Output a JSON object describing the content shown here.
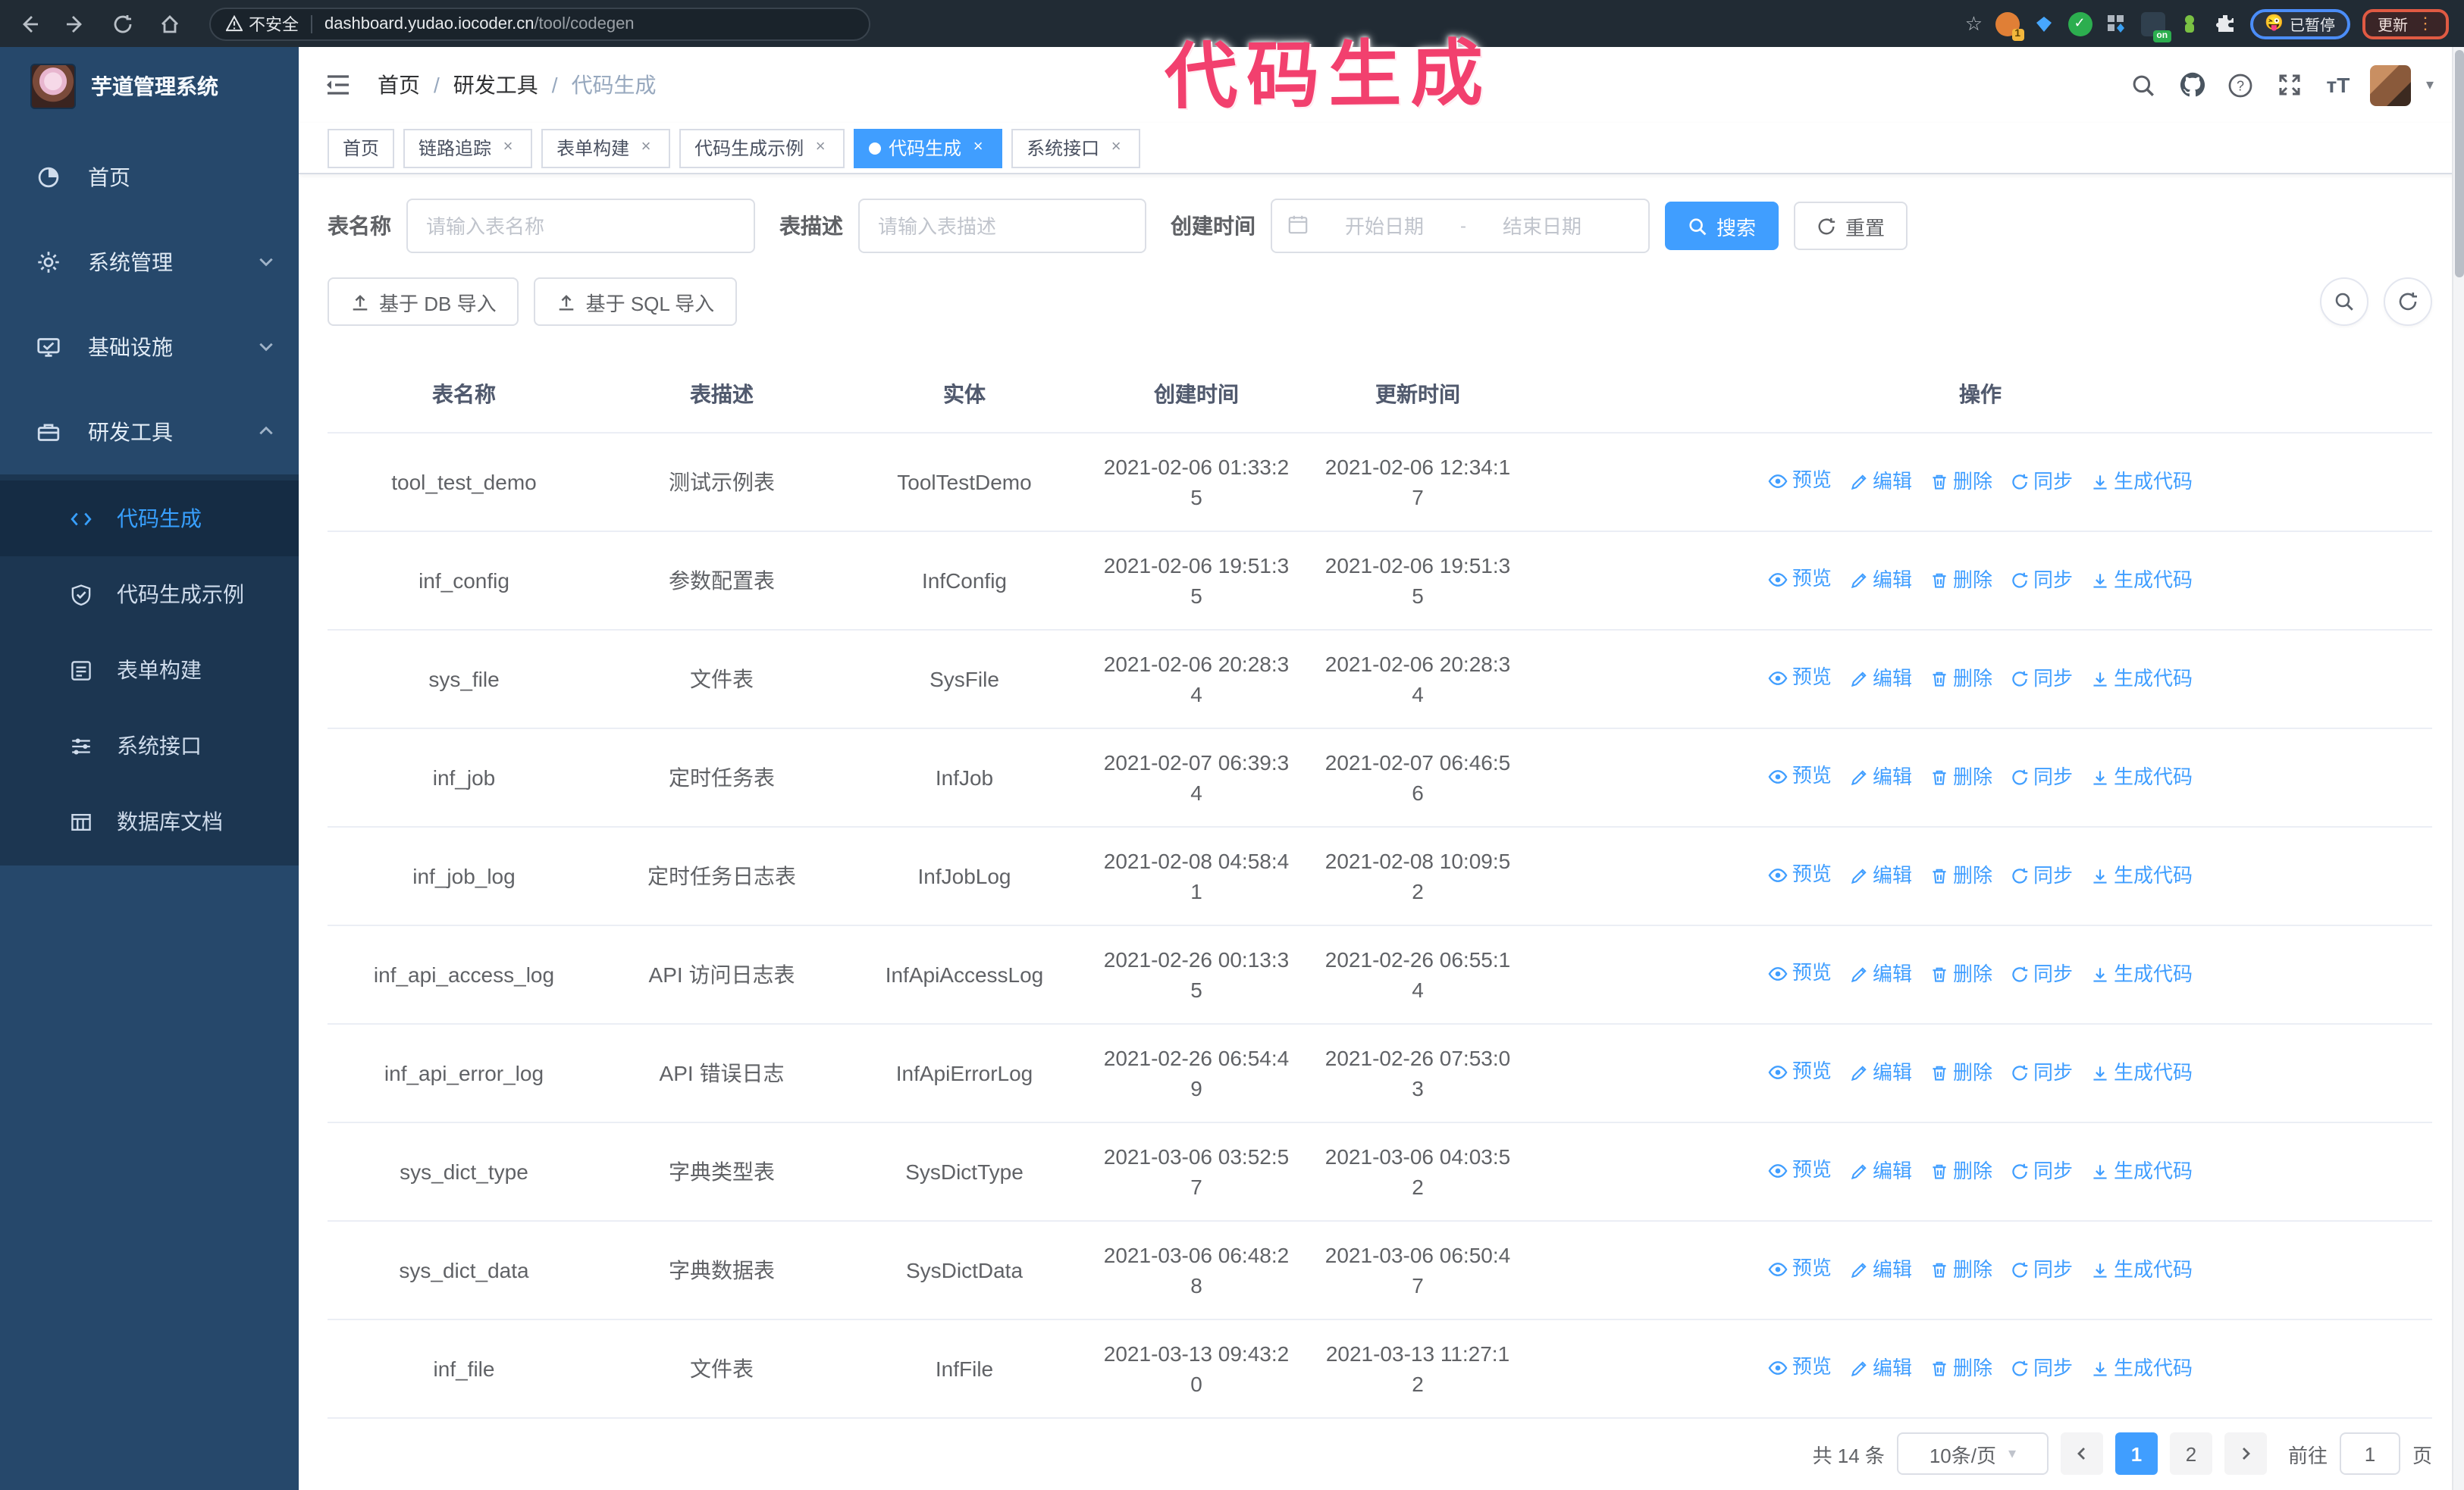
{
  "colors": {
    "accent": "#409eff",
    "annotation_pink": "#f2406e",
    "sidebar_bg": "#26486b",
    "submenu_bg": "#1c3651",
    "chrome_bg": "#212b34"
  },
  "glyphs": {
    "close": "×",
    "slash": "/",
    "dash": "-",
    "caret_down": "▾",
    "dots_vertical": "⋮",
    "star": "☆",
    "back": "←",
    "forward": "→"
  },
  "browser": {
    "security_label": "不安全",
    "url_host": "dashboard.yudao.iocoder.cn",
    "url_path": "/tool/codegen",
    "extension_badge": "1",
    "extension_on": "on",
    "paused_badge": "已暂停",
    "paused_emoji": "😜",
    "update_button": "更新"
  },
  "annotation": {
    "text": "代码生成"
  },
  "sidebar": {
    "title": "芋道管理系统",
    "top": [
      {
        "label": "首页"
      },
      {
        "label": "系统管理"
      },
      {
        "label": "基础设施"
      },
      {
        "label": "研发工具"
      }
    ],
    "sub": [
      {
        "label": "代码生成"
      },
      {
        "label": "代码生成示例"
      },
      {
        "label": "表单构建"
      },
      {
        "label": "系统接口"
      },
      {
        "label": "数据库文档"
      }
    ]
  },
  "header": {
    "breadcrumb": [
      "首页",
      "研发工具",
      "代码生成"
    ]
  },
  "tabs": [
    {
      "label": "首页"
    },
    {
      "label": "链路追踪"
    },
    {
      "label": "表单构建"
    },
    {
      "label": "代码生成示例"
    },
    {
      "label": "代码生成"
    },
    {
      "label": "系统接口"
    }
  ],
  "filters": {
    "table_name_label": "表名称",
    "table_name_placeholder": "请输入表名称",
    "table_desc_label": "表描述",
    "table_desc_placeholder": "请输入表描述",
    "create_time_label": "创建时间",
    "start_placeholder": "开始日期",
    "end_placeholder": "结束日期",
    "search_button": "搜索",
    "reset_button": "重置"
  },
  "toolbar": {
    "import_db": "基于 DB 导入",
    "import_sql": "基于 SQL 导入"
  },
  "table": {
    "columns": [
      "表名称",
      "表描述",
      "实体",
      "创建时间",
      "更新时间",
      "操作"
    ],
    "actions": [
      {
        "label": "预览",
        "icon": "eye"
      },
      {
        "label": "编辑",
        "icon": "edit"
      },
      {
        "label": "删除",
        "icon": "delete"
      },
      {
        "label": "同步",
        "icon": "sync"
      },
      {
        "label": "生成代码",
        "icon": "download"
      }
    ],
    "rows": [
      {
        "name": "tool_test_demo",
        "desc": "测试示例表",
        "entity": "ToolTestDemo",
        "created": "2021-02-06 01:33:25",
        "updated": "2021-02-06 12:34:17"
      },
      {
        "name": "inf_config",
        "desc": "参数配置表",
        "entity": "InfConfig",
        "created": "2021-02-06 19:51:35",
        "updated": "2021-02-06 19:51:35"
      },
      {
        "name": "sys_file",
        "desc": "文件表",
        "entity": "SysFile",
        "created": "2021-02-06 20:28:34",
        "updated": "2021-02-06 20:28:34"
      },
      {
        "name": "inf_job",
        "desc": "定时任务表",
        "entity": "InfJob",
        "created": "2021-02-07 06:39:34",
        "updated": "2021-02-07 06:46:56"
      },
      {
        "name": "inf_job_log",
        "desc": "定时任务日志表",
        "entity": "InfJobLog",
        "created": "2021-02-08 04:58:41",
        "updated": "2021-02-08 10:09:52"
      },
      {
        "name": "inf_api_access_log",
        "desc": "API 访问日志表",
        "entity": "InfApiAccessLog",
        "created": "2021-02-26 00:13:35",
        "updated": "2021-02-26 06:55:14"
      },
      {
        "name": "inf_api_error_log",
        "desc": "API 错误日志",
        "entity": "InfApiErrorLog",
        "created": "2021-02-26 06:54:49",
        "updated": "2021-02-26 07:53:03"
      },
      {
        "name": "sys_dict_type",
        "desc": "字典类型表",
        "entity": "SysDictType",
        "created": "2021-03-06 03:52:57",
        "updated": "2021-03-06 04:03:52"
      },
      {
        "name": "sys_dict_data",
        "desc": "字典数据表",
        "entity": "SysDictData",
        "created": "2021-03-06 06:48:28",
        "updated": "2021-03-06 06:50:47"
      },
      {
        "name": "inf_file",
        "desc": "文件表",
        "entity": "InfFile",
        "created": "2021-03-13 09:43:20",
        "updated": "2021-03-13 11:27:12"
      }
    ]
  },
  "pagination": {
    "total": "共 14 条",
    "page_size": "10条/页",
    "pages": [
      "1",
      "2"
    ],
    "active_page": "1",
    "goto_label": "前往",
    "goto_value": "1",
    "goto_suffix": "页"
  }
}
